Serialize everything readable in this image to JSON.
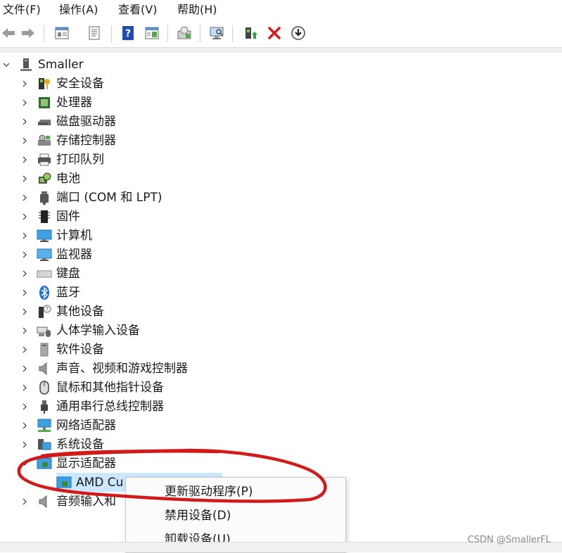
{
  "menubar": {
    "items": [
      {
        "label": "文件(F)"
      },
      {
        "label": "操作(A)"
      },
      {
        "label": "查看(V)"
      },
      {
        "label": "帮助(H)"
      }
    ]
  },
  "toolbar": {
    "buttons": [
      {
        "icon": "back-arrow-icon"
      },
      {
        "icon": "forward-arrow-icon"
      },
      {
        "icon": "properties-panel-icon"
      },
      {
        "icon": "document-properties-icon"
      },
      {
        "icon": "help-icon"
      },
      {
        "icon": "view-pane-icon"
      },
      {
        "icon": "update-driver-icon"
      },
      {
        "icon": "scan-hardware-monitor-icon"
      },
      {
        "icon": "add-legacy-hardware-icon"
      },
      {
        "icon": "uninstall-x-icon"
      },
      {
        "icon": "download-circle-icon"
      }
    ]
  },
  "tree": {
    "root": {
      "label": "Smaller",
      "expanded": true
    },
    "categories": [
      {
        "label": "安全设备",
        "icon": "security-key-icon"
      },
      {
        "label": "处理器",
        "icon": "cpu-chip-icon"
      },
      {
        "label": "磁盘驱动器",
        "icon": "disk-drive-icon"
      },
      {
        "label": "存储控制器",
        "icon": "storage-controller-icon"
      },
      {
        "label": "打印队列",
        "icon": "printer-icon"
      },
      {
        "label": "电池",
        "icon": "battery-icon"
      },
      {
        "label": "端口 (COM 和 LPT)",
        "icon": "port-icon"
      },
      {
        "label": "固件",
        "icon": "firmware-chip-icon"
      },
      {
        "label": "计算机",
        "icon": "computer-monitor-icon"
      },
      {
        "label": "监视器",
        "icon": "monitor-icon"
      },
      {
        "label": "键盘",
        "icon": "keyboard-icon"
      },
      {
        "label": "蓝牙",
        "icon": "bluetooth-icon"
      },
      {
        "label": "其他设备",
        "icon": "unknown-device-icon"
      },
      {
        "label": "人体学输入设备",
        "icon": "hid-device-icon"
      },
      {
        "label": "软件设备",
        "icon": "software-device-icon"
      },
      {
        "label": "声音、视频和游戏控制器",
        "icon": "speaker-icon"
      },
      {
        "label": "鼠标和其他指针设备",
        "icon": "mouse-icon"
      },
      {
        "label": "通用串行总线控制器",
        "icon": "usb-plug-icon"
      },
      {
        "label": "网络适配器",
        "icon": "network-adapter-icon"
      },
      {
        "label": "系统设备",
        "icon": "system-device-icon"
      },
      {
        "label": "显示适配器",
        "icon": "display-adapter-icon",
        "expanded": true
      },
      {
        "label": "音频输入和",
        "icon": "audio-io-icon"
      }
    ],
    "child": {
      "label": "AMD Cu",
      "icon": "display-adapter-icon"
    }
  },
  "context_menu": {
    "items": [
      {
        "label": "更新驱动程序(P)"
      },
      {
        "label": "禁用设备(D)"
      },
      {
        "label": "卸载设备(U)"
      }
    ]
  },
  "watermark": "CSDN @SmallerFL",
  "colors": {
    "selection": "#cce8ff",
    "annotation": "#d11a1a",
    "uninstall_x": "#e01a1a",
    "help_blue": "#1e4fb0"
  }
}
